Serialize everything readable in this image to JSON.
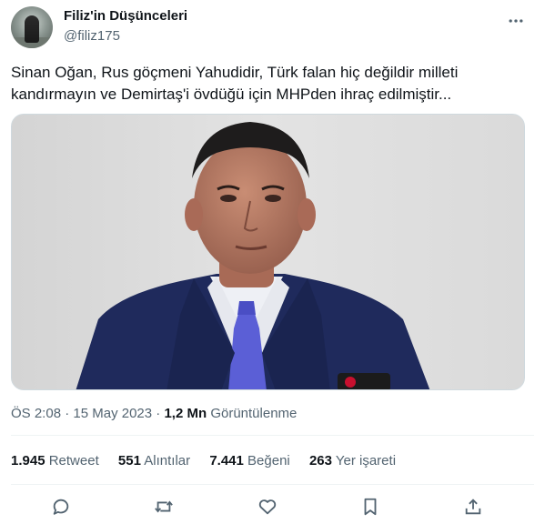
{
  "author": {
    "name": "Filiz'in Düşünceleri",
    "handle": "@filiz175",
    "avatar_icon": "profile-photo"
  },
  "tweet": {
    "text_line1": "Sinan Oğan, Rus göçmeni Yahudidir, Türk falan hiç değildir milleti",
    "text_line2": "kandırmayın  ve  Demirtaş'i övdüğü için MHPden ihraç  edilmiştir...",
    "time": "ÖS 2:08",
    "date": "15 May 2023",
    "separator": "·",
    "views_count": "1,2 Mn",
    "views_label": "Görüntülenme"
  },
  "stats": {
    "retweets_count": "1.945",
    "retweets_label": "Retweet",
    "quotes_count": "551",
    "quotes_label": "Alıntılar",
    "likes_count": "7.441",
    "likes_label": "Beğeni",
    "bookmarks_count": "263",
    "bookmarks_label": "Yer işareti"
  },
  "actions": [
    "reply-icon",
    "retweet-icon",
    "like-icon",
    "bookmark-icon",
    "share-icon"
  ],
  "colors": {
    "text": "#0f1419",
    "secondary": "#536471",
    "divider": "#eff3f4",
    "suit": "#1f2a5c",
    "tie": "#5b5fd6"
  }
}
